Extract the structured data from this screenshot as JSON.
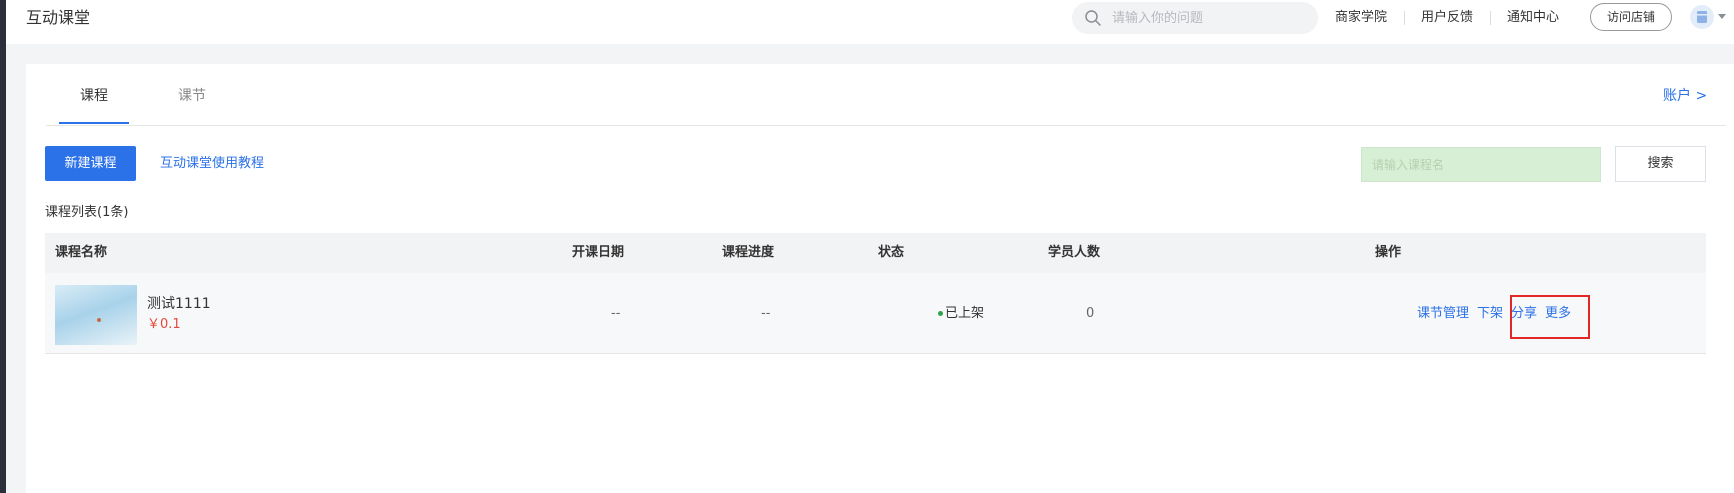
{
  "app": {
    "title": "互动课堂"
  },
  "topbar": {
    "search_placeholder": "请输入你的问题",
    "links": [
      "商家学院",
      "用户反馈",
      "通知中心"
    ],
    "visit_store": "访问店铺"
  },
  "tabs": [
    {
      "label": "课程",
      "active": true
    },
    {
      "label": "课节",
      "active": false
    }
  ],
  "account_link": "账户 >",
  "toolbar": {
    "new_course": "新建课程",
    "tutorial": "互动课堂使用教程",
    "course_search_placeholder": "请输入课程名",
    "search_button": "搜索"
  },
  "list": {
    "count_label": "课程列表(1条)",
    "headers": [
      "课程名称",
      "开课日期",
      "课程进度",
      "状态",
      "学员人数",
      "操作"
    ],
    "rows": [
      {
        "name": "测试1111",
        "price": "￥0.1",
        "start_date": "--",
        "progress": "--",
        "status": "已上架",
        "students": "0",
        "actions": [
          "课节管理",
          "下架",
          "分享",
          "更多"
        ]
      }
    ]
  },
  "colors": {
    "accent": "#2b71e8",
    "price": "#e44a3b",
    "status_online": "#2ca44a",
    "highlight": "#e32626"
  },
  "icons": [
    "search-icon",
    "avatar-icon",
    "caret-down-icon"
  ]
}
